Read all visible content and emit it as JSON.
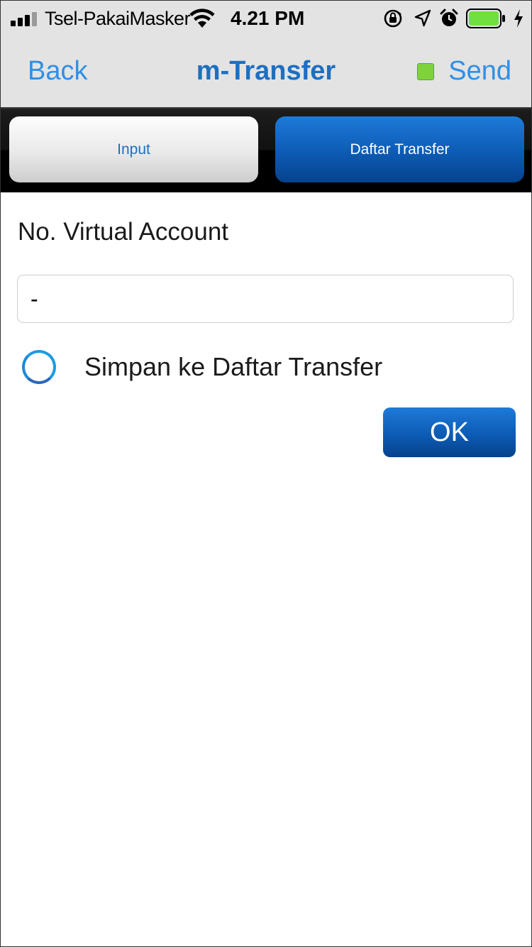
{
  "status_bar": {
    "carrier": "Tsel-PakaiMasker",
    "time": "4.21 PM",
    "signal_icon": "cellular-signal-icon",
    "wifi_icon": "wifi-icon",
    "battery_icon": "battery-icon",
    "battery_color": "#6fe03f"
  },
  "nav": {
    "back_label": "Back",
    "title": "m-Transfer",
    "send_label": "Send",
    "accent": "#2f8fe6",
    "title_color": "#1d6fc0",
    "send_indicator_color": "#7fd23a"
  },
  "tabs": [
    {
      "label": "Input",
      "active": false
    },
    {
      "label": "Daftar Transfer",
      "active": true
    }
  ],
  "form": {
    "field_label": "No. Virtual Account",
    "field_value": "-",
    "save_option_label": "Simpan ke Daftar Transfer",
    "save_option_checked": false,
    "ok_label": "OK"
  }
}
